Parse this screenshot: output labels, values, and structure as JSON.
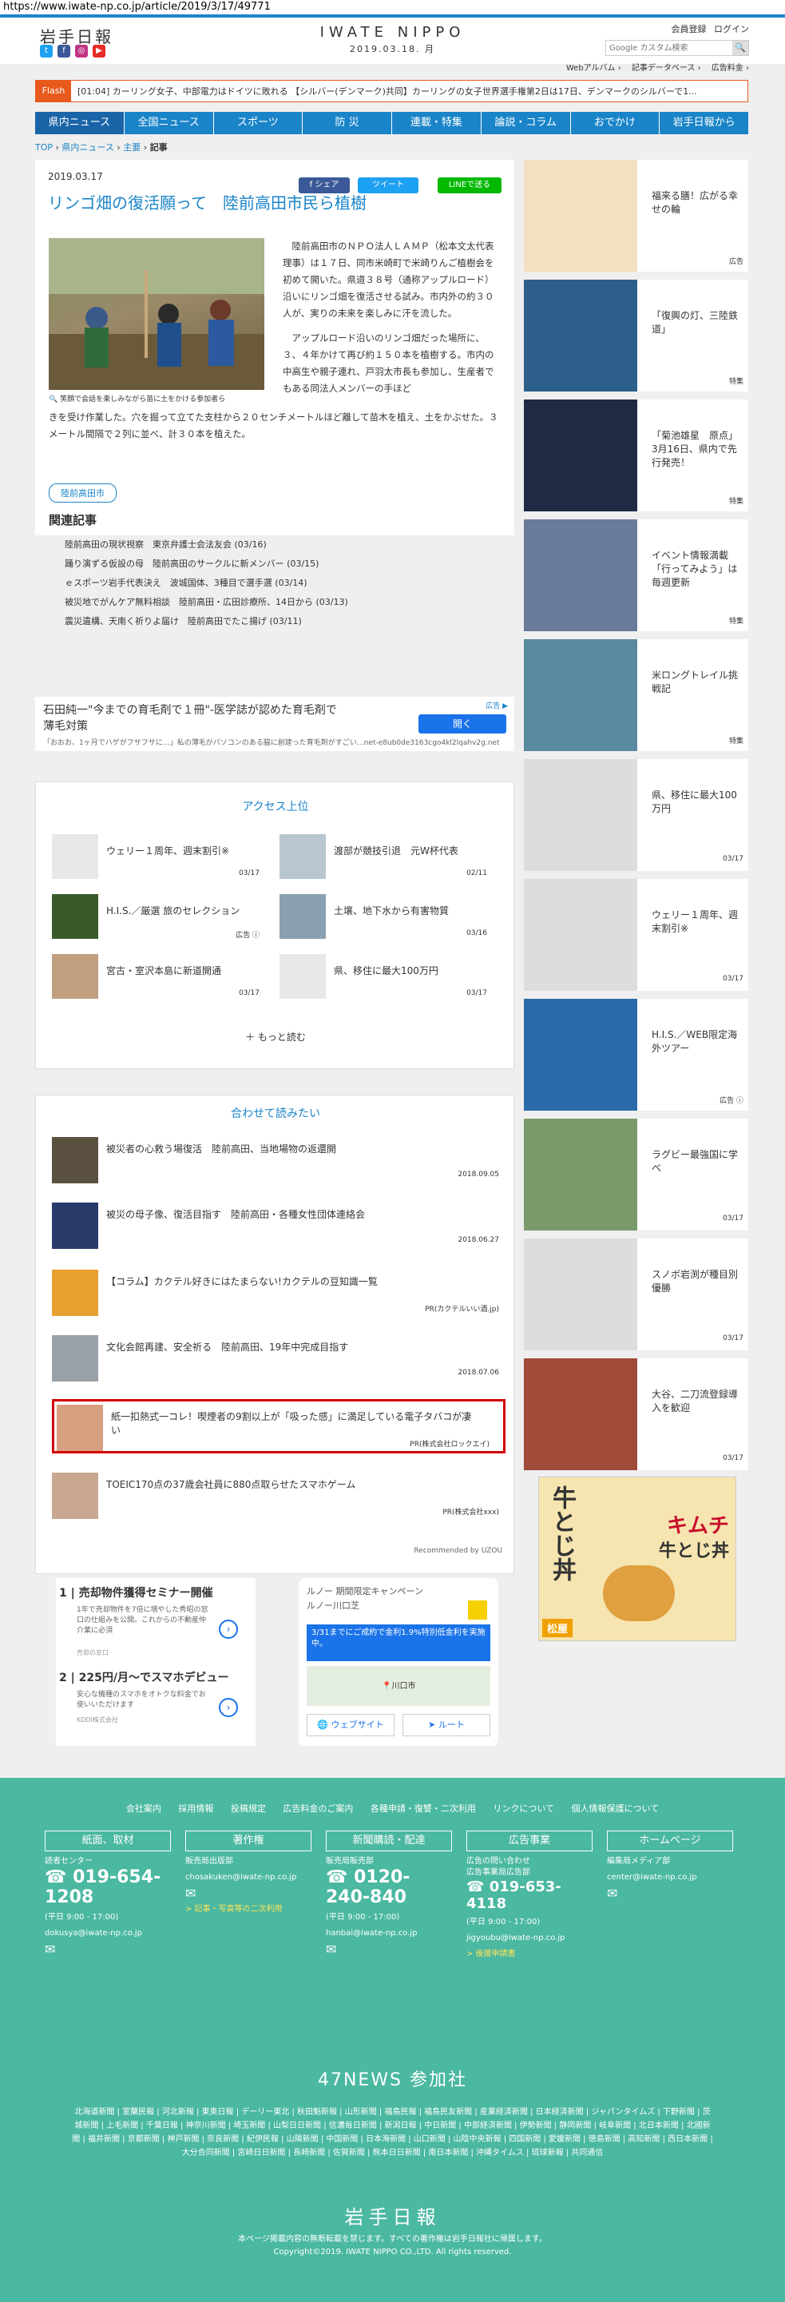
{
  "url": "https://www.iwate-np.co.jp/article/2019/3/17/49771",
  "header": {
    "logo_left": "岩手日報",
    "brand": "IWATE NIPPO",
    "date": "2019.03.18. 月",
    "member_reg": "会員登録",
    "login": "ログイン",
    "search_placeholder": "Google カスタム検索",
    "sub_links": [
      "Webアルバム ›",
      "記事データベース ›",
      "広告料金 ›"
    ]
  },
  "flash": {
    "label": "Flash",
    "text": "[01:04] カーリング女子、中部電力はドイツに敗れる 【シルバー(デンマーク)共同】カーリングの女子世界選手権第2日は17日、デンマークのシルバーで1..."
  },
  "nav": [
    "県内ニュース",
    "全国ニュース",
    "スポーツ",
    "防 災",
    "連載・特集",
    "論説・コラム",
    "おでかけ",
    "岩手日報から"
  ],
  "breadcrumb": [
    "TOP",
    "県内ニュース",
    "主要",
    "記事"
  ],
  "article": {
    "date": "2019.03.17",
    "title": "リンゴ畑の復活願って　陸前高田市民ら植樹",
    "share": [
      "f シェア",
      "ツイート",
      "LINEで送る"
    ],
    "caption": "🔍 笑顔で会話を楽しみながら苗に土をかける参加者ら",
    "body1": "　陸前高田市のＮＰＯ法人ＬＡＭＰ（松本文太代表理事）は１７日、同市米崎町で米崎りんご植樹会を初めて開いた。県道３８号（通称アップルロード）沿いにリンゴ畑を復活させる試み。市内外の約３０人が、実りの未来を楽しみに汗を流した。",
    "body1b": "　アップルロード沿いのリンゴ畑だった場所に、３、４年かけて再び約１５０本を植樹する。市内の中高生や親子連れ、戸羽太市長も参加し、生産者でもある同法人メンバーの手ほど",
    "body2": "きを受け作業した。穴を掘って立てた支柱から２０センチメートルほど離して苗木を植え、土をかぶせた。３メートル間隔で２列に並べ、計３０本を植えた。",
    "tag": "陸前高田市",
    "related_heading": "関連記事",
    "related": [
      "陸前高田の現状視察　東京弁護士会法友会 (03/16)",
      "踊り演ずる仮設の母　陸前高田のサークルに新メンバー (03/15)",
      "ｅスポーツ岩手代表決え　波城国体、3種目で選手選 (03/14)",
      "被災地でがんケア無料相談　陸前高田・広田診療所、14日から (03/13)",
      "震災遺構、天南く祈りよ届け　陸前高田でたこ揚げ (03/11)"
    ]
  },
  "ad1": {
    "title": "石田純一\"今までの育毛剤で１冊\"‐医学誌が認めた育毛剤で薄毛対策",
    "sub": "「おおお、1ヶ月でハゲがフサフサに…」私の薄毛がパソコンのある脇に創建った育毛剤がすごい…net-e8ub0de3163cgo4kl2lqahv2g.net",
    "button": "開く",
    "label": "広告 ▶"
  },
  "access": {
    "heading": "アクセス上位",
    "items": [
      {
        "title": "ウェリー１周年、週末割引※",
        "date": "03/17"
      },
      {
        "title": "渡部が競技引退　元W杯代表",
        "date": "02/11"
      },
      {
        "title": "H.I.S.／厳選 旅のセレクション",
        "date": "広告 ⓘ"
      },
      {
        "title": "土壌、地下水から有害物質",
        "date": "03/16"
      },
      {
        "title": "宮古・室沢本島に新道開通",
        "date": "03/17"
      },
      {
        "title": "県、移住に最大100万円",
        "date": "03/17"
      }
    ],
    "more": "もっと読む"
  },
  "recommend": {
    "heading": "合わせて読みたい",
    "items": [
      {
        "title": "被災者の心救う場復活　陸前高田、当地場物の返還開",
        "meta": "2018.09.05"
      },
      {
        "title": "被災の母子像、復活目指す　陸前高田・各種女性団体連絡会",
        "meta": "2018.06.27"
      },
      {
        "title": "【コラム】カクテル好きにはたまらない!カクテルの豆知識一覧",
        "meta": "PR(カクテルいい酒.jp)"
      },
      {
        "title": "文化会館再建、安全祈る　陸前高田、19年中完成目指す",
        "meta": "2018.07.06"
      },
      {
        "title": "紙一扣熱式一コレ！喫煙者の9割以上が「吸った感」に満足している電子タバコが凄い",
        "meta": "PR(株式会社ロックエイ)"
      },
      {
        "title": "TOEIC170点の37歳会社員に880点取らせたスマホゲーム",
        "meta": "PR(株式会社xxx)"
      }
    ],
    "powered": "Recommended by UZOU"
  },
  "ads2": {
    "t1": "売却物件獲得セミナー開催",
    "d1": "1年で売却物件を7倍に増やした秀昭の窓口の仕組みを公開。これからの不動産仲介業に必須",
    "s1": "売却の窓口",
    "t2": "225円/月〜でスマホデビュー",
    "d2": "安心な機種のスマホをオトクな料金でお使いいただけます",
    "s2": "KDDI株式会社"
  },
  "ads3": {
    "title": "ルノー 期間限定キャンペーン",
    "brand": "ルノー川口芝",
    "msg": "3/31までにご成約で金利1.9%特別低金利を実施中。",
    "map": "川口市",
    "btn1": "ウェブサイト",
    "btn2": "ルート"
  },
  "sidebar": [
    {
      "title": "福来る膳！広がる幸せの輪",
      "meta": "広告"
    },
    {
      "title": "「復興の灯、三陸鉄道」",
      "meta": "特集"
    },
    {
      "title": "「菊池雄星　原点」3月16日、県内で先行発売！",
      "meta": "特集"
    },
    {
      "title": "イベント情報満載「行ってみよう」は毎週更新",
      "meta": "特集"
    },
    {
      "title": "米ロングトレイル挑戦記",
      "meta": "特集"
    },
    {
      "title": "県、移住に最大100万円",
      "meta": "03/17"
    },
    {
      "title": "ウェリー１周年、週末割引※",
      "meta": "03/17"
    },
    {
      "title": "H.I.S.／WEB限定海外ツアー",
      "meta": "広告 ⓘ"
    },
    {
      "title": "ラグビー最強国に学べ",
      "meta": "03/17"
    },
    {
      "title": "スノボ岩渕が種目別優勝",
      "meta": "03/17"
    },
    {
      "title": "大谷、二刀流登録導入を歓迎",
      "meta": "03/17"
    }
  ],
  "sidebar_ad": {
    "left": "牛とじ丼",
    "right1": "キムチ",
    "right2": "牛とじ丼",
    "brand": "松屋"
  },
  "footer": {
    "links": [
      "会社案内",
      "採用情報",
      "投稿規定",
      "広告料金のご案内",
      "各種申請・復讐・二次利用",
      "リンクについて",
      "個人情報保護について"
    ],
    "cols": [
      {
        "head": "紙面、取材",
        "sub": "読者センター",
        "phone": "019-654-1208",
        "hours": "(平日 9:00 - 17:00)",
        "mail": "dokusya@iwate-np.co.jp"
      },
      {
        "head": "著作権",
        "sub": "販売局出版部",
        "phone": "",
        "hours": "",
        "mail": "chosakuken@iwate-np.co.jp",
        "extra": "> 記事・写真等の二次利用"
      },
      {
        "head": "新聞購読・配達",
        "sub": "販売局販売部",
        "phone": "0120-240-840",
        "hours": "(平日 9:00 - 17:00)",
        "mail": "hanbai@iwate-np.co.jp"
      },
      {
        "head": "広告事業",
        "sub": "広告の問い合わせ\n広告事業局広告部",
        "phone": "019-653-4118",
        "hours": "(平日 9:00 - 17:00)",
        "mail": "jigyoubu@iwate-np.co.jp",
        "extra": "> 後援申請書"
      },
      {
        "head": "ホームページ",
        "sub": "編集局メディア部",
        "phone": "",
        "hours": "",
        "mail": "center@iwate-np.co.jp"
      }
    ],
    "news47": "47NEWS 参加社",
    "papers": "北海道新聞 | 室蘭民報 | 河北新報 | 東奥日報 | デーリー東北 | 秋田魁新報 | 山形新聞 | 福島民報 | 福島民友新聞 | 産業経済新聞 | 日本経済新聞 | ジャパンタイムズ | 下野新聞 | 茨城新聞 | 上毛新聞 | 千葉日報 | 神奈川新聞 | 埼玉新聞 | 山梨日日新聞 | 信濃毎日新聞 | 新潟日報 | 中日新聞 | 中部経済新聞 | 伊勢新聞 | 静岡新聞 | 岐阜新聞 | 北日本新聞 | 北國新聞 | 福井新聞 | 京都新聞 | 神戸新聞 | 奈良新聞 | 紀伊民報 | 山陽新聞 | 中国新聞 | 日本海新聞 | 山口新聞 | 山陰中央新報 | 四国新聞 | 愛媛新聞 | 徳島新聞 | 高知新聞 | 西日本新聞 | 大分合同新聞 | 宮崎日日新聞 | 長崎新聞 | 佐賀新聞 | 熊本日日新聞 | 南日本新聞 | 沖縄タイムス | 琉球新報 | 共同通信",
    "logo": "岩手日報",
    "notice": "本ページ掲載内容の無断転載を禁じます。すべての著作権は岩手日報社に帰属します。",
    "copyright": "Copyright©2019. IWATE NIPPO CO.,LTD. All rights reserved."
  }
}
